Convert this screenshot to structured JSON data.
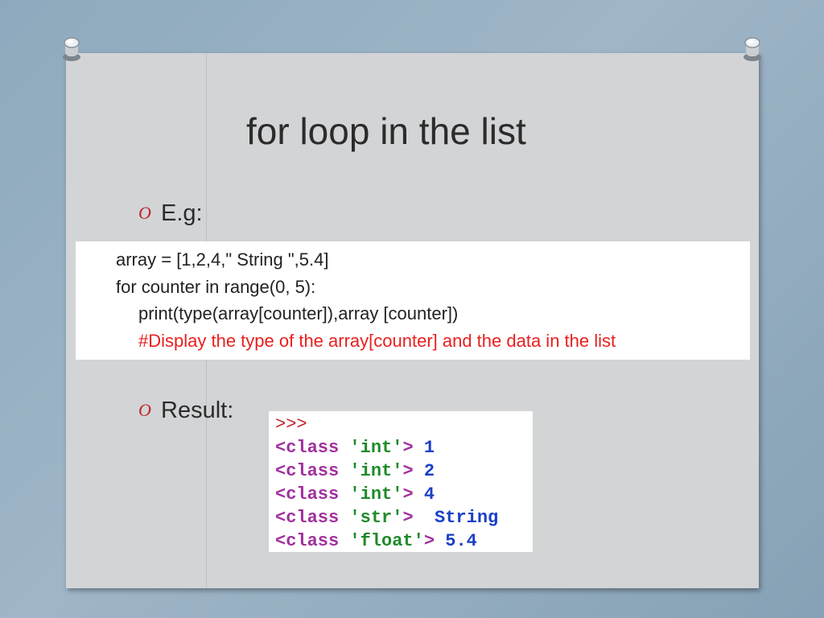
{
  "slide": {
    "title": "for loop in the list",
    "bullets": [
      {
        "marker": "O",
        "label": "E.g:"
      },
      {
        "marker": "O",
        "label": "Result:"
      }
    ]
  },
  "code": {
    "lines": [
      "array = [1,2,4,\" String \",5.4]",
      "for counter in range(0, 5):",
      "print(type(array[counter]),array [counter])",
      "#Display the type of the array[counter] and the data in the list"
    ],
    "comment_color": "#e8201f"
  },
  "result": {
    "prompt": ">>>",
    "rows": [
      {
        "cls": "<class ",
        "type": "'int'",
        "close": "> ",
        "value": "1"
      },
      {
        "cls": "<class ",
        "type": "'int'",
        "close": "> ",
        "value": "2"
      },
      {
        "cls": "<class ",
        "type": "'int'",
        "close": "> ",
        "value": "4"
      },
      {
        "cls": "<class ",
        "type": "'str'",
        "close": ">  ",
        "value": "String"
      },
      {
        "cls": "<class ",
        "type": "'float'",
        "close": "> ",
        "value": "5.4"
      }
    ]
  },
  "colors": {
    "background": "#8ea9bd",
    "slide": "#d3d4d6",
    "bullet_marker": "#c0262b"
  },
  "icons": {
    "pin_left": "pushpin-icon",
    "pin_right": "pushpin-icon"
  }
}
